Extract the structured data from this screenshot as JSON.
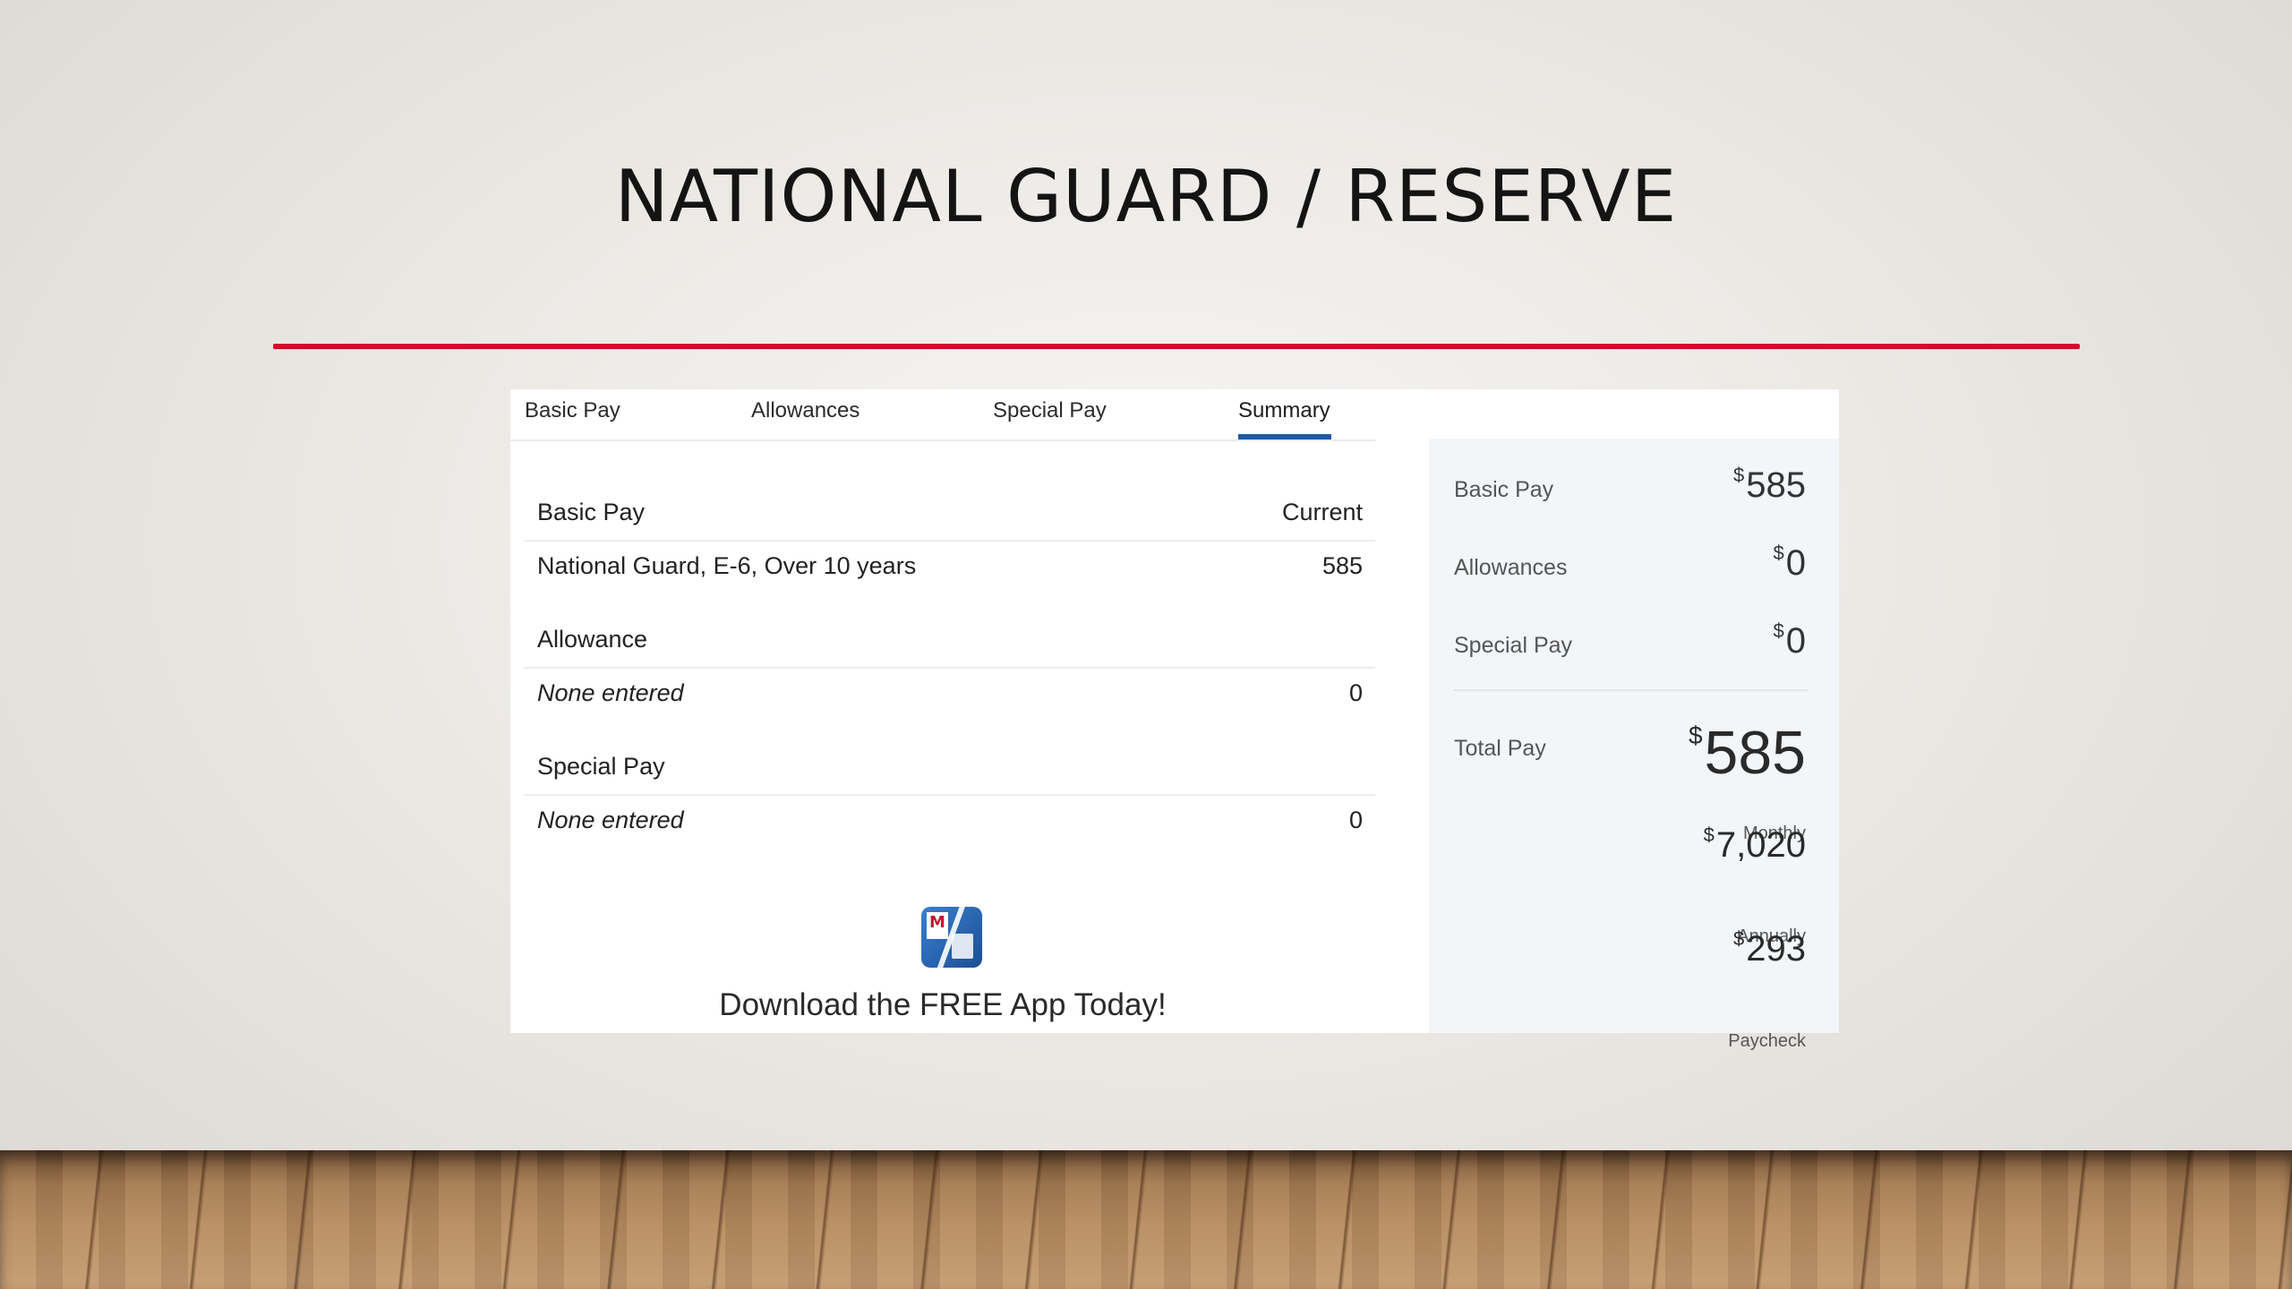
{
  "slide": {
    "title": "NATIONAL GUARD / RESERVE"
  },
  "tabs": [
    {
      "label": "Basic Pay"
    },
    {
      "label": "Allowances"
    },
    {
      "label": "Special Pay"
    },
    {
      "label": "Summary",
      "active": true
    }
  ],
  "table": {
    "header": {
      "label": "Basic Pay",
      "value": "Current"
    },
    "basic_row": {
      "label": "National Guard, E-6, Over 10 years",
      "value": "585"
    },
    "allowance_header": "Allowance",
    "allowance_row": {
      "label": "None entered",
      "value": "0"
    },
    "special_header": "Special Pay",
    "special_row": {
      "label": "None entered",
      "value": "0"
    }
  },
  "promo": {
    "text": "Download the FREE App Today!",
    "icon": "app-calculator-icon"
  },
  "summary": {
    "currency": "$",
    "basic_pay": {
      "label": "Basic Pay",
      "value": "585"
    },
    "allowances": {
      "label": "Allowances",
      "value": "0"
    },
    "special_pay": {
      "label": "Special Pay",
      "value": "0"
    },
    "total": {
      "label": "Total Pay",
      "value": "585",
      "period": "Monthly"
    },
    "annual": {
      "value": "7,020",
      "period": "Annually"
    },
    "paycheck": {
      "value": "293",
      "period": "Paycheck"
    }
  },
  "colors": {
    "accent_rule": "#c8102e",
    "tab_active": "#1e5aa6",
    "summary_bg": "#f3f6f8"
  }
}
